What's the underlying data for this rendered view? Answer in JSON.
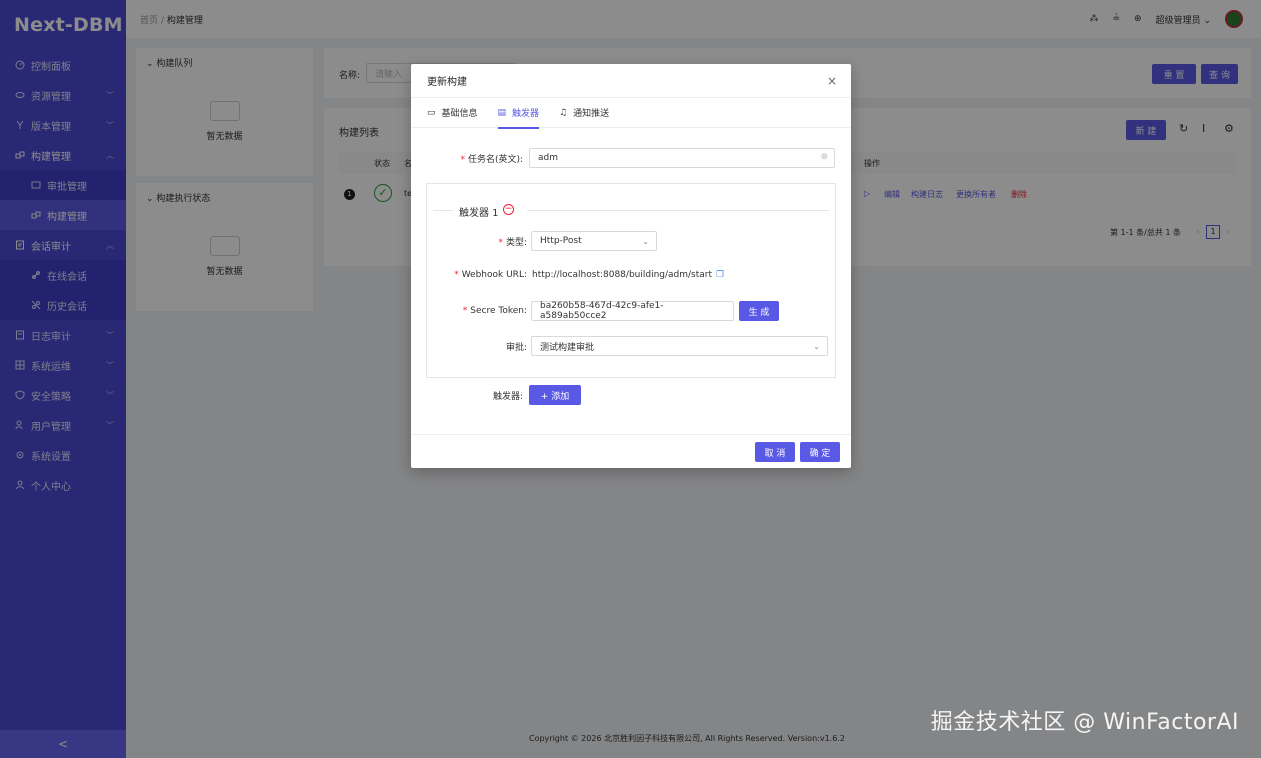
{
  "app": {
    "logo": "Next-DBM"
  },
  "sidebar": {
    "items": [
      {
        "label": "控制面板",
        "icon": "dashboard-icon"
      },
      {
        "label": "资源管理",
        "icon": "resource-icon",
        "arrow": "﹀"
      },
      {
        "label": "版本管理",
        "icon": "version-icon",
        "arrow": "﹀"
      },
      {
        "label": "构建管理",
        "icon": "build-icon",
        "arrow": "︿"
      },
      {
        "label": "审批管理",
        "icon": "approval-icon"
      },
      {
        "label": "构建管理",
        "icon": "build-icon"
      },
      {
        "label": "会话审计",
        "icon": "session-icon",
        "arrow": "︿"
      },
      {
        "label": "在线会话",
        "icon": "link-icon"
      },
      {
        "label": "历史会话",
        "icon": "link-broken-icon"
      },
      {
        "label": "日志审计",
        "icon": "log-icon",
        "arrow": "﹀"
      },
      {
        "label": "系统运维",
        "icon": "ops-icon",
        "arrow": "﹀"
      },
      {
        "label": "安全策略",
        "icon": "shield-icon",
        "arrow": "﹀"
      },
      {
        "label": "用户管理",
        "icon": "user-icon",
        "arrow": "﹀"
      },
      {
        "label": "系统设置",
        "icon": "gear-icon"
      },
      {
        "label": "个人中心",
        "icon": "person-icon"
      }
    ],
    "collapse": "<"
  },
  "header": {
    "breadcrumb_home": "首页",
    "breadcrumb_sep": "/",
    "breadcrumb_current": "构建管理",
    "user": "超级管理员"
  },
  "left_panels": {
    "queue_title": "构建队列",
    "queue_empty": "暂无数据",
    "status_title": "构建执行状态",
    "status_empty": "暂无数据"
  },
  "search": {
    "name_label": "名称:",
    "name_placeholder": "请输入",
    "reset": "重 置",
    "query": "查 询"
  },
  "list": {
    "title": "构建列表",
    "new": "新 建",
    "col_status": "状态",
    "col_name": "名",
    "col_action": "操作",
    "row_index": "1",
    "row_name": "te",
    "actions": [
      "编辑",
      "构建日志",
      "更换所有者",
      "删除"
    ],
    "pagination": "第 1-1 条/总共 1 条",
    "page": "1"
  },
  "modal": {
    "title": "更新构建",
    "close": "×",
    "tabs": [
      {
        "label": "基础信息",
        "icon": "monitor-icon"
      },
      {
        "label": "触发器",
        "icon": "trigger-icon"
      },
      {
        "label": "通知推送",
        "icon": "bell-icon"
      }
    ],
    "task_label": "任务名(英文):",
    "task_value": "adm",
    "trigger_title": "触发器 1",
    "type_label": "类型:",
    "type_value": "Http-Post",
    "webhook_label": "Webhook URL:",
    "webhook_value": "http://localhost:8088/building/adm/start",
    "token_label": "Secre Token:",
    "token_value": "ba260b58-467d-42c9-afe1-a589ab50cce2",
    "generate": "生 成",
    "approval_label": "审批:",
    "approval_value": "测试构建审批",
    "trigger_label": "触发器:",
    "add": "+ 添加",
    "cancel": "取 消",
    "ok": "确 定"
  },
  "footer": {
    "copyright": "Copyright © 2026 北京胜利因子科技有限公司, All Rights Reserved. Version:v1.6.2"
  },
  "watermark": "掘金技术社区 @ WinFactorAI"
}
